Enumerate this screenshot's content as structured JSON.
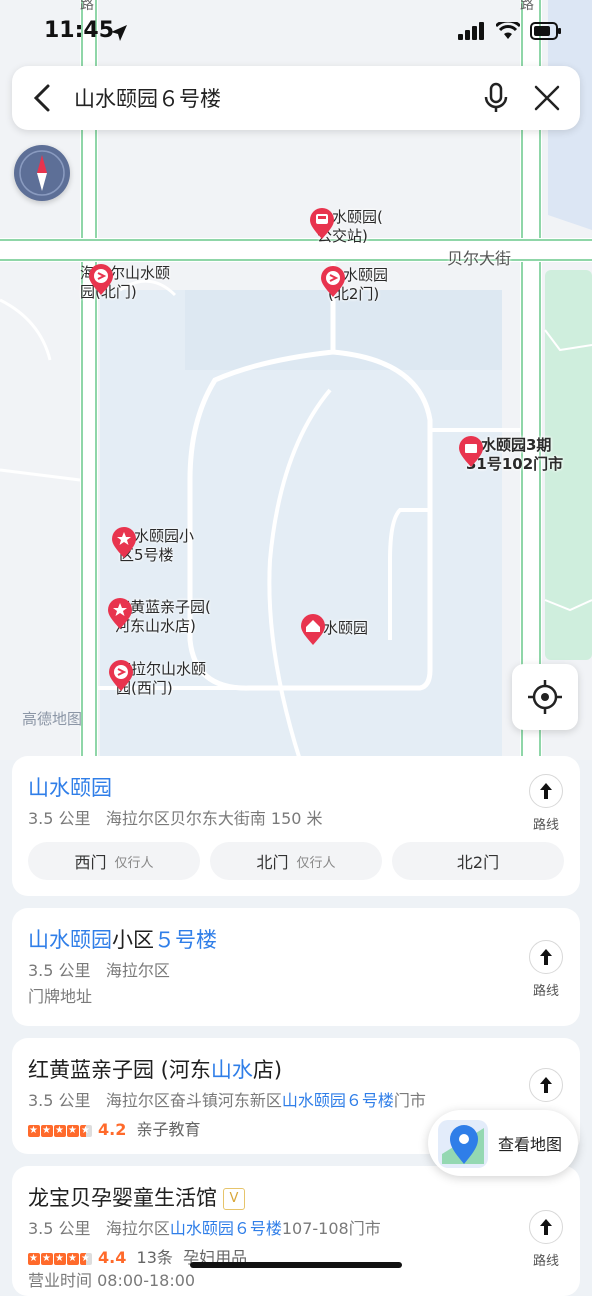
{
  "status_bar": {
    "time": "11:45"
  },
  "search": {
    "query": "山水颐园６号楼",
    "back_icon": "chevron-left-icon",
    "mic_icon": "microphone-icon",
    "clear_icon": "close-icon"
  },
  "map": {
    "road_labels": {
      "top_left": "路",
      "top_right": "路",
      "street": "贝尔大街"
    },
    "pois": [
      {
        "name": "山水颐园(\n公交站)",
        "type": "bus"
      },
      {
        "name": "海拉尔山水颐\n园(北门)",
        "type": "gate"
      },
      {
        "name": "山水颐园\n(北2门)",
        "type": "gate"
      },
      {
        "name": "山水颐园3期\n31号102门市",
        "type": "shop"
      },
      {
        "name": "山水颐园小\n区5号楼",
        "type": "star"
      },
      {
        "name": "红黄蓝亲子园(\n河东山水店)",
        "type": "star"
      },
      {
        "name": "山水颐园",
        "type": "home"
      },
      {
        "name": "海拉尔山水颐\n园(西门)",
        "type": "gate"
      }
    ],
    "watermark": "高德地图"
  },
  "results": [
    {
      "title_hl": "山水颐园",
      "distance": "3.5 公里",
      "address": "海拉尔区贝尔东大街南 150 米",
      "route_label": "路线",
      "chips": [
        {
          "label": "西门",
          "note": "仅行人"
        },
        {
          "label": "北门",
          "note": "仅行人"
        },
        {
          "label": "北2门",
          "note": ""
        }
      ]
    },
    {
      "title_hl1": "山水颐园",
      "title_plain": "小区",
      "title_hl2": "５号楼",
      "distance": "3.5 公里",
      "address": "海拉尔区",
      "tag": "门牌地址",
      "route_label": "路线"
    },
    {
      "title_plain1": "红黄蓝亲子园 (河东",
      "title_hl": "山水",
      "title_plain2": "店)",
      "distance": "3.5 公里",
      "address_plain": "海拉尔区奋斗镇河东新区",
      "address_hl": "山水颐园６号楼",
      "address_tail": "门市",
      "rating": "4.2",
      "category": "亲子教育",
      "route_label": "路线"
    },
    {
      "title": "龙宝贝孕婴童生活馆",
      "badge": "V",
      "distance": "3.5 公里",
      "address_plain": "海拉尔区",
      "address_hl": "山水颐园６号楼",
      "address_tail": "107-108门市",
      "rating": "4.4",
      "reviews": "13条",
      "category": "孕妇用品",
      "hours": "营业时间 08:00-18:00",
      "route_label": "路线"
    }
  ],
  "view_map": {
    "label": "查看地图"
  },
  "colors": {
    "accent": "#2f7ee8",
    "pin": "#e8344e",
    "rating": "#ff6a2b"
  }
}
